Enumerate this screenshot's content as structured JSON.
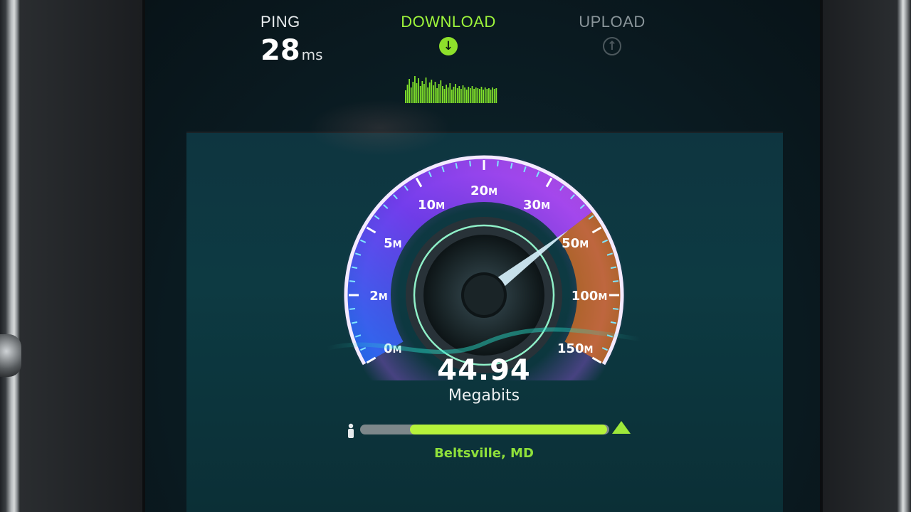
{
  "header": {
    "ping_label": "PING",
    "ping_value": "28",
    "ping_unit": "ms",
    "download_label": "DOWNLOAD",
    "download_icon": "arrow-down-circle-icon",
    "upload_label": "UPLOAD",
    "upload_icon": "arrow-up-circle-icon"
  },
  "gauge": {
    "ticks": [
      {
        "num": "0",
        "unit": "M"
      },
      {
        "num": "2",
        "unit": "M"
      },
      {
        "num": "5",
        "unit": "M"
      },
      {
        "num": "10",
        "unit": "M"
      },
      {
        "num": "20",
        "unit": "M"
      },
      {
        "num": "30",
        "unit": "M"
      },
      {
        "num": "50",
        "unit": "M"
      },
      {
        "num": "100",
        "unit": "M"
      },
      {
        "num": "150",
        "unit": "M"
      }
    ],
    "needle_value": 44.94
  },
  "result": {
    "value": "44.94",
    "unit": "Megabits"
  },
  "server": {
    "location": "Beltsville, MD",
    "progress_start": 0.2,
    "progress_end": 0.99,
    "person_icon": "person-icon",
    "server_icon": "server-flag-icon"
  },
  "colors": {
    "accent_green": "#9ef53b",
    "gauge_purple": "#7a3cff",
    "gauge_blue": "#2b6cff",
    "gauge_orange": "#ff7a1a"
  }
}
